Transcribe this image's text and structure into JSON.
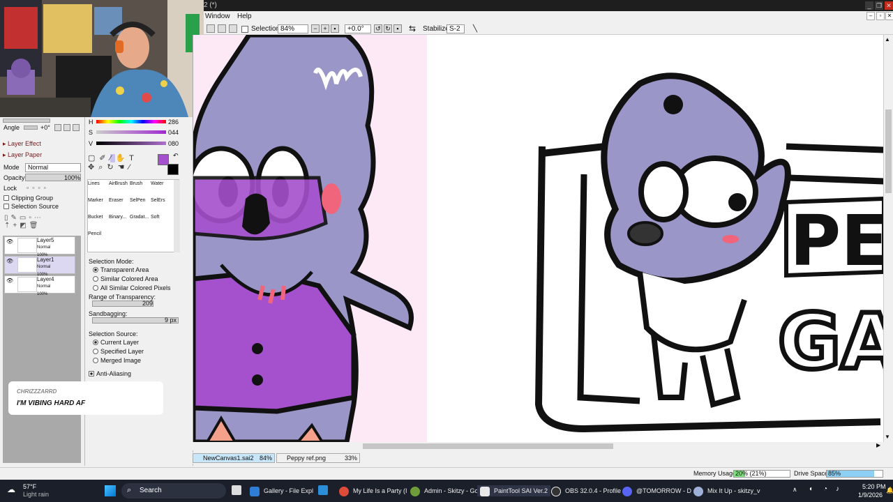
{
  "window": {
    "title_suffix": "2 (*)",
    "controls": [
      "_",
      "❐",
      "✕"
    ],
    "mdi_controls": [
      "–",
      "▫",
      "✕"
    ]
  },
  "menu": {
    "items": [
      "Window",
      "Help"
    ]
  },
  "toolbar": {
    "selection_label": "Selection",
    "zoom": "84%",
    "rotation": "+0.0°",
    "stabilizer_label": "Stabilizer",
    "stabilizer_value": "S-2"
  },
  "left_panel": {
    "angle_label": "Angle",
    "angle_value": "+0°",
    "layer_effect": "Layer Effect",
    "layer_paper": "Layer Paper",
    "mode_label": "Mode",
    "mode_value": "Normal",
    "opacity_label": "Opacity",
    "opacity_value": "100%",
    "lock_label": "Lock",
    "clipping_group": "Clipping Group",
    "selection_source": "Selection Source"
  },
  "layers": [
    {
      "name": "Layer5",
      "mode": "Normal",
      "opacity": "100%"
    },
    {
      "name": "Layer1",
      "mode": "Normal",
      "opacity": "100%"
    },
    {
      "name": "Layer4",
      "mode": "Normal",
      "opacity": "100%"
    }
  ],
  "color": {
    "h": "286",
    "s": "044",
    "v": "080",
    "h_label": "H",
    "s_label": "S",
    "v_label": "V",
    "fg": "#a551cd",
    "bg": "#000000"
  },
  "brushes": [
    "Lines",
    "AirBrush",
    "Brush",
    "Water",
    "Marker",
    "Eraser",
    "SelPen",
    "SelErs",
    "Bucket",
    "Binary...",
    "Gradat...",
    "Soft",
    "Pencil"
  ],
  "tool_options": {
    "selection_mode_label": "Selection Mode:",
    "modes": [
      "Transparent Area",
      "Similar Colored Area",
      "All Similar Colored Pixels"
    ],
    "range_label": "Range of Transparency:",
    "range_value": "209",
    "sandbag_label": "Sandbagging:",
    "sandbag_value": "9 px",
    "source_label": "Selection Source:",
    "sources": [
      "Current Layer",
      "Specified Layer",
      "Merged Image"
    ],
    "antialias": "Anti-Aliasing"
  },
  "chat": {
    "user": "CHRIZZZARRD",
    "message": "I'M VIBING HARD AF"
  },
  "canvas": {
    "sign_text_1": "PE",
    "sign_text_2": "GAS"
  },
  "docs": [
    {
      "name": "NewCanvas1.sai2",
      "zoom": "84%"
    },
    {
      "name": "Peppy ref.png",
      "zoom": "33%"
    }
  ],
  "status": {
    "memory_label": "Memory Usage",
    "memory_value": "20% (21%)",
    "memory_fraction": 0.2,
    "drive_label": "Drive Space",
    "drive_value": "85%",
    "drive_fraction": 0.85
  },
  "taskbar": {
    "weather_temp": "57°F",
    "weather_desc": "Light rain",
    "search": "Search",
    "apps": [
      "Gallery - File Expl",
      "My Life Is a Party (I",
      "Admin - Skitzy - Go",
      "PaintTool SAI Ver.2",
      "OBS 32.0.4 - Profile",
      "@TOMORROW - D",
      "Mix It Up - skitzy_v"
    ],
    "time": "5:20 PM",
    "date": "1/9/2026"
  },
  "colors": {
    "char_purple": "#9b96c8",
    "shirt": "#a551cd",
    "pink_bg": "#fde8f6",
    "blush": "#f0647c"
  }
}
